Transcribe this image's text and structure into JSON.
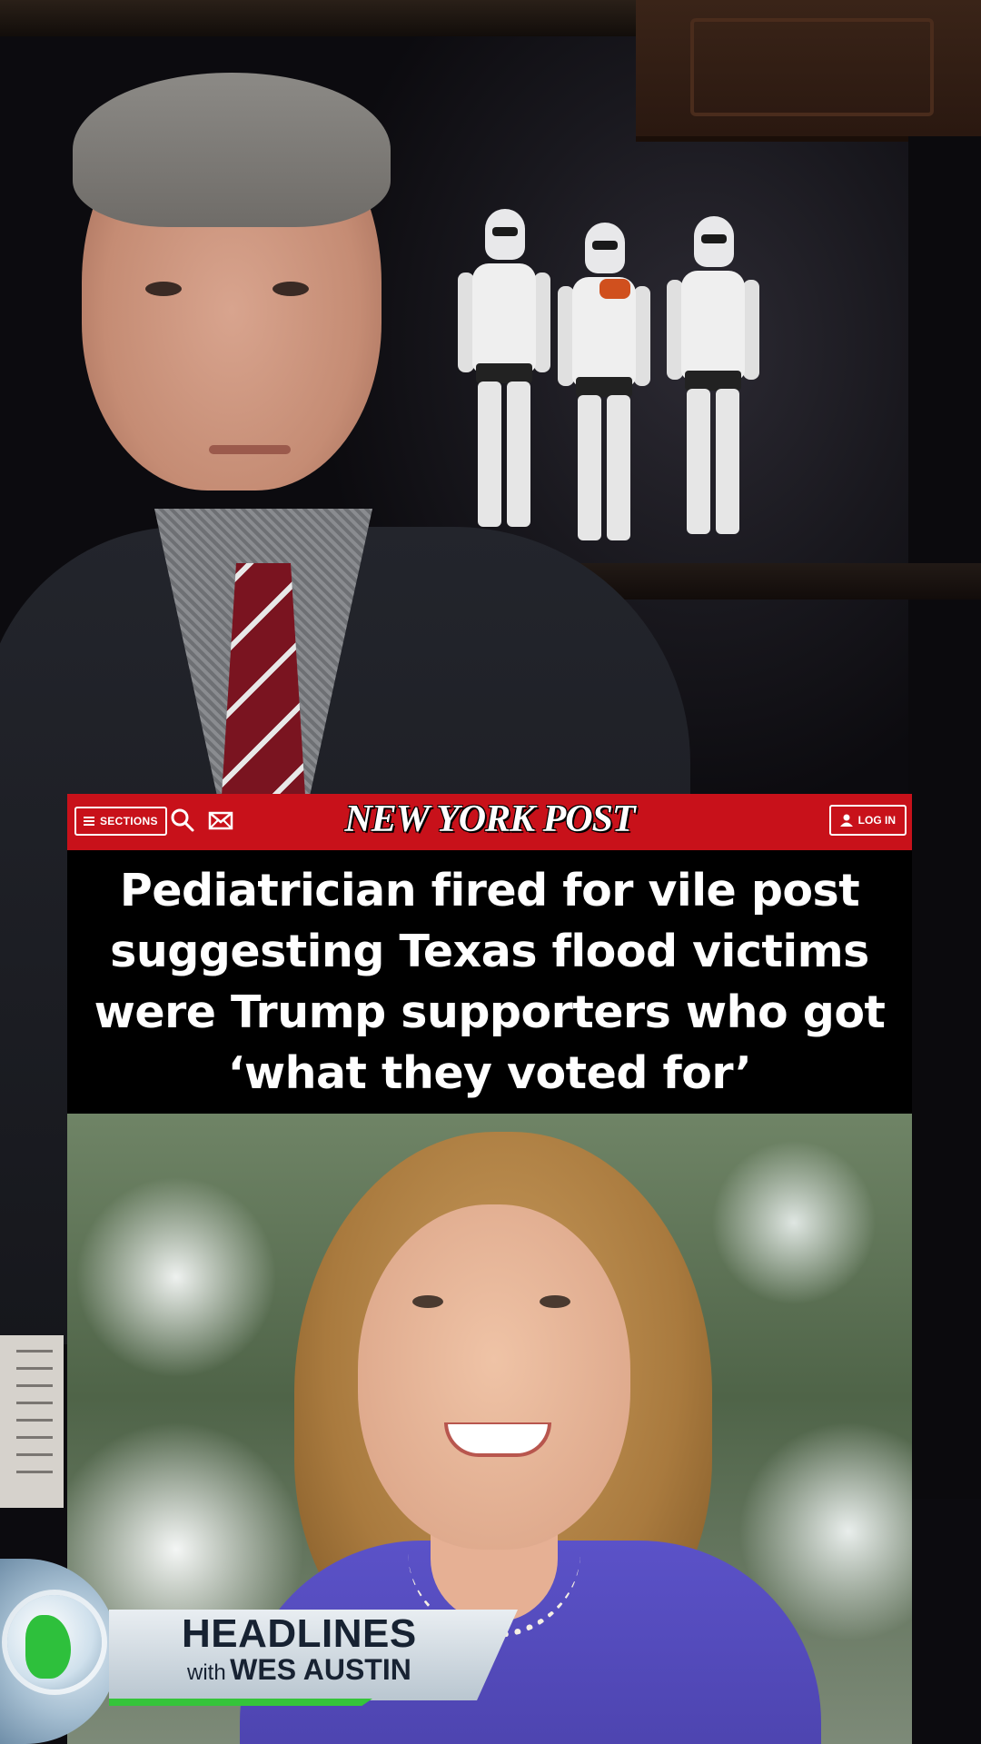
{
  "nav": {
    "sections_label": "SECTIONS",
    "logo": "NEW YORK POST",
    "login_label": "LOG IN"
  },
  "article": {
    "headline": "Pediatrician fired for vile post suggesting Texas flood victims were Trump supporters who got ‘what they voted for’"
  },
  "lower_third": {
    "title": "HEADLINES",
    "with": "with",
    "host": "WES AUSTIN"
  },
  "colors": {
    "nyp_red": "#c8111a",
    "lower_third_accent": "#35c43a",
    "lower_third_text": "#172232"
  }
}
